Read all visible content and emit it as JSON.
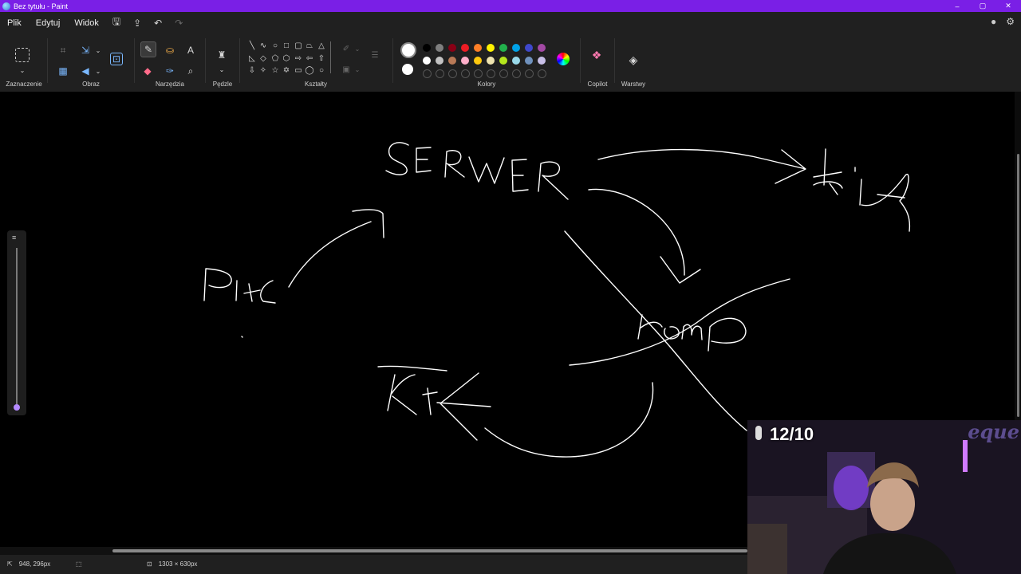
{
  "window": {
    "title": "Bez tytułu - Paint",
    "controls": [
      "–",
      "▢",
      "✕"
    ]
  },
  "menu": {
    "items": [
      "Plik",
      "Edytuj",
      "Widok"
    ]
  },
  "ribbon": {
    "groups": {
      "selection": "Zaznaczenie",
      "image": "Obraz",
      "tools": "Narzędzia",
      "brushes": "Pędzle",
      "shapes": "Kształty",
      "colors": "Kolory",
      "copilot": "Copilot",
      "layers": "Warstwy"
    },
    "palette_row1": [
      "#000000",
      "#7f7f7f",
      "#880015",
      "#ed1c24",
      "#ff7f27",
      "#fff200",
      "#22b14c",
      "#00a2e8",
      "#3f48cc",
      "#a349a4"
    ],
    "palette_row2": [
      "#ffffff",
      "#c3c3c3",
      "#b97a57",
      "#ffaec9",
      "#ffc90e",
      "#efe4b0",
      "#b5e61d",
      "#99d9ea",
      "#7092be",
      "#c8bfe7"
    ],
    "primary_color": "#ffffff",
    "secondary_color": "#ffffff"
  },
  "canvas": {
    "drawing_words": {
      "serwer": "SERWER",
      "gra": "GRA",
      "piec": "PIEC",
      "komp": "KOMP",
      "kit": "KIT"
    }
  },
  "status": {
    "cursor_pos": "948, 296px",
    "canvas_size": "1303 × 630px"
  },
  "overlay": {
    "score": "12/10",
    "brand": "eque"
  }
}
